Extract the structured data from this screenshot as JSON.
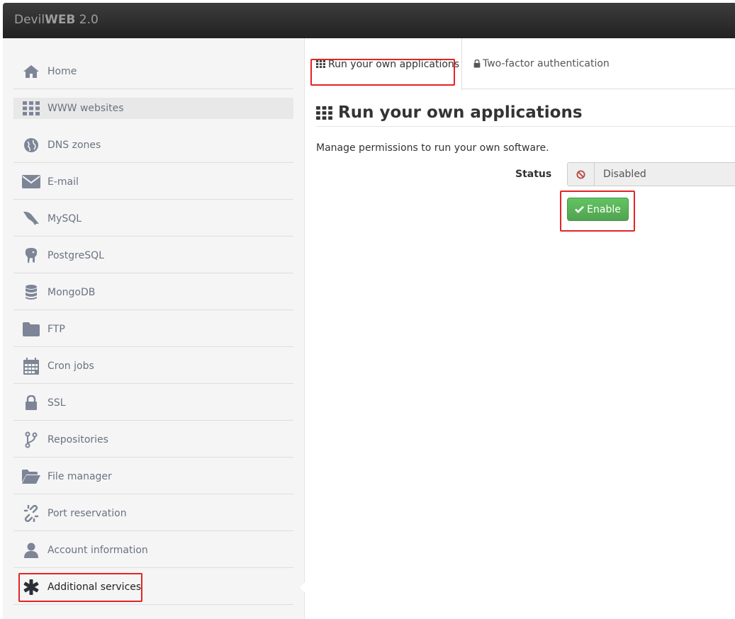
{
  "brand": {
    "prefix": "Devil",
    "bold": "WEB",
    "version": "2.0"
  },
  "sidebar": {
    "items": [
      {
        "label": "Home",
        "icon": "home-icon"
      },
      {
        "label": "WWW websites",
        "icon": "grid-icon",
        "active": true
      },
      {
        "label": "DNS zones",
        "icon": "globe-icon"
      },
      {
        "label": "E-mail",
        "icon": "envelope-icon"
      },
      {
        "label": "MySQL",
        "icon": "dolphin-icon"
      },
      {
        "label": "PostgreSQL",
        "icon": "elephant-icon"
      },
      {
        "label": "MongoDB",
        "icon": "database-icon"
      },
      {
        "label": "FTP",
        "icon": "folder-icon"
      },
      {
        "label": "Cron jobs",
        "icon": "calendar-icon"
      },
      {
        "label": "SSL",
        "icon": "lock-icon"
      },
      {
        "label": "Repositories",
        "icon": "branch-icon"
      },
      {
        "label": "File manager",
        "icon": "folder-open-icon"
      },
      {
        "label": "Port reservation",
        "icon": "unlink-icon"
      },
      {
        "label": "Account information",
        "icon": "user-icon"
      },
      {
        "label": "Additional services",
        "icon": "asterisk-icon"
      }
    ]
  },
  "tabs": [
    {
      "label": "Run your own applications",
      "icon": "grid-icon"
    },
    {
      "label": "Two-factor authentication",
      "icon": "lock-icon"
    }
  ],
  "main": {
    "title": "Run your own applications",
    "description": "Manage permissions to run your own software.",
    "status_label": "Status",
    "status_value": "Disabled",
    "enable_button": "Enable"
  },
  "colors": {
    "highlight": "#e32424",
    "enable_button": "#5cb85c",
    "sidebar_text": "#6a7282"
  }
}
